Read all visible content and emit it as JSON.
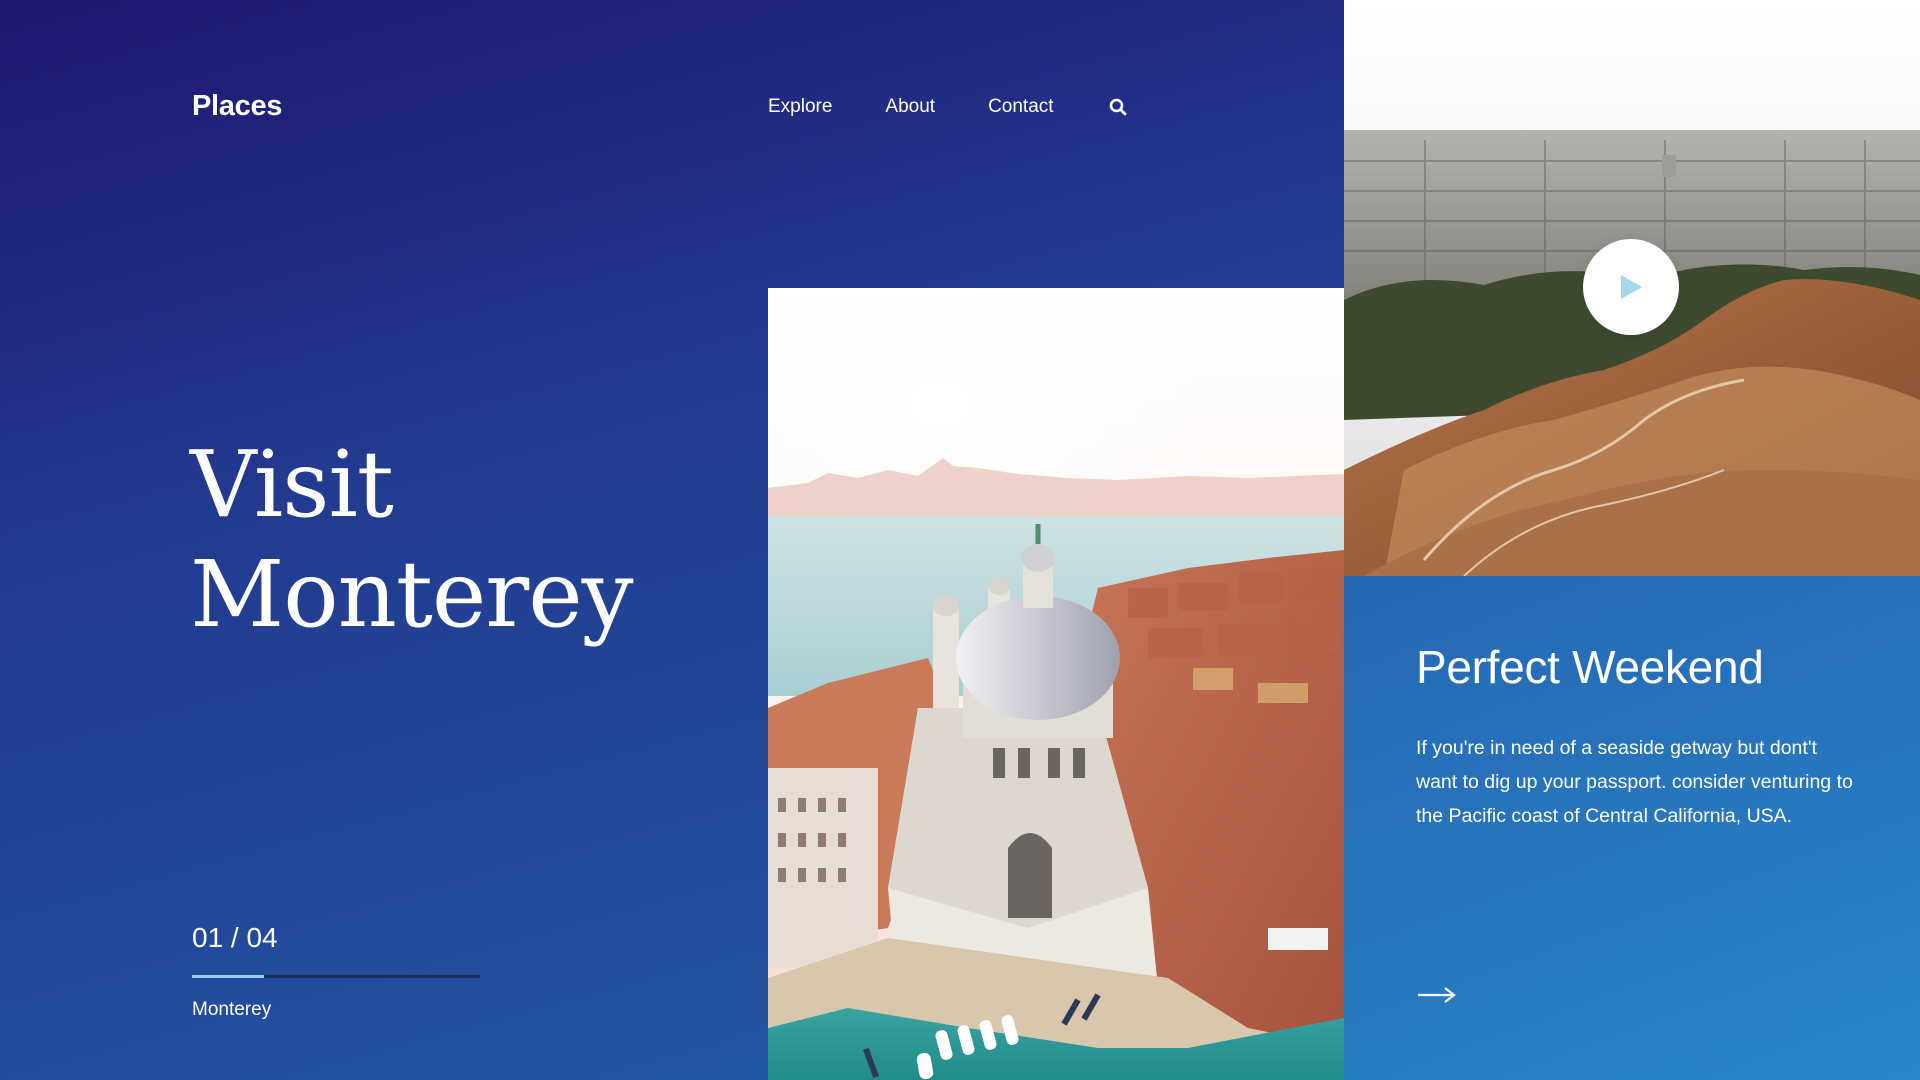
{
  "header": {
    "logo": "Places",
    "nav": [
      {
        "label": "Explore"
      },
      {
        "label": "About"
      },
      {
        "label": "Contact"
      }
    ],
    "search_icon": "search-icon"
  },
  "hero": {
    "title_line1": "Visit",
    "title_line2": "Monterey"
  },
  "slider": {
    "counter": "01 / 04",
    "progress": 0.25,
    "current_name": "Monterey"
  },
  "media": {
    "center_image": "venice-aerial-photo",
    "top_right_image": "mountain-city-aerial-photo",
    "play_icon": "play-icon"
  },
  "info": {
    "title": "Perfect Weekend",
    "body": "If you're in need of a seaside getway but dont't want to dig up your passport. consider venturing to the Pacific coast of Central California, USA.",
    "arrow_icon": "arrow-right-icon"
  },
  "colors": {
    "accent": "#8fd3f0",
    "background_dark": "#1f1770",
    "background_light": "#2460aa",
    "panel": "#2a7dc2"
  }
}
